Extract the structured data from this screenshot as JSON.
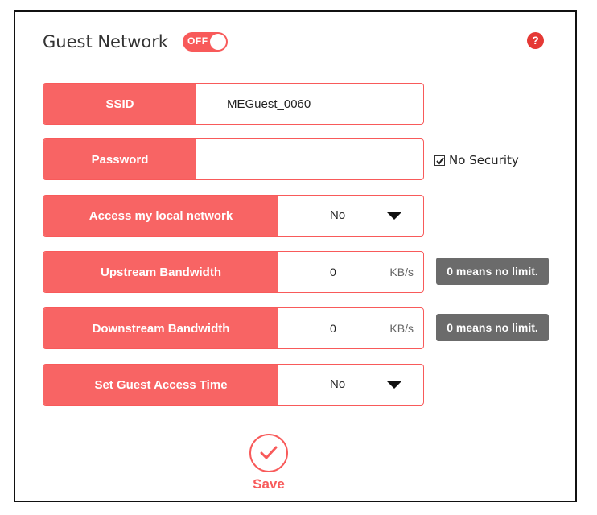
{
  "header": {
    "title": "Guest Network",
    "toggle_label": "OFF",
    "help": "?"
  },
  "ssid": {
    "label": "SSID",
    "value": "MEGuest_0060"
  },
  "password": {
    "label": "Password",
    "value": "",
    "no_security_label": "No Security",
    "no_security_checked": true
  },
  "access_local": {
    "label": "Access my local network",
    "value": "No"
  },
  "upstream": {
    "label": "Upstream Bandwidth",
    "value": "0",
    "unit": "KB/s",
    "hint": "0 means no limit."
  },
  "downstream": {
    "label": "Downstream Bandwidth",
    "value": "0",
    "unit": "KB/s",
    "hint": "0 means no limit."
  },
  "guest_time": {
    "label": "Set Guest Access Time",
    "value": "No"
  },
  "save": {
    "label": "Save"
  },
  "colors": {
    "accent": "#f85a5a",
    "hint_bg": "#6b6b6b",
    "help": "#e53935"
  },
  "icons": {
    "help": "help-icon",
    "dropdown": "chevron-down-icon",
    "save": "checkmark-icon",
    "checkbox": "checkbox-checked-icon"
  }
}
